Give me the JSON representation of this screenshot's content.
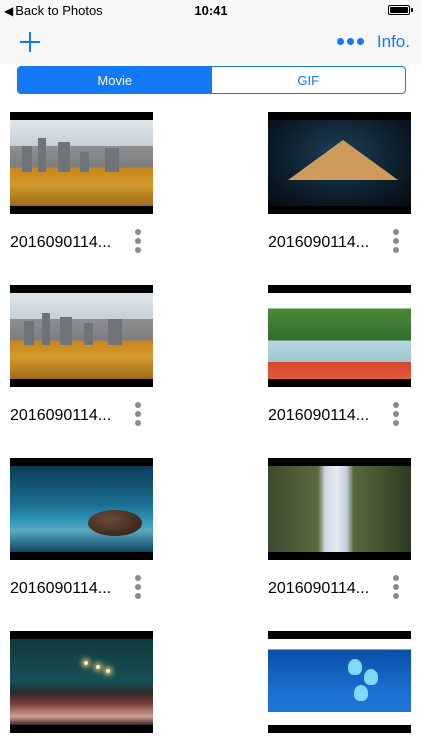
{
  "status_bar": {
    "back_label": "Back to Photos",
    "time": "10:41"
  },
  "nav": {
    "add_icon": "plus-icon",
    "more_icon": "ellipsis-icon",
    "info_label": "Info."
  },
  "tabs": [
    {
      "label": "Movie",
      "active": true
    },
    {
      "label": "GIF",
      "active": false
    }
  ],
  "items": [
    {
      "caption": "2016090114...",
      "scene": "city"
    },
    {
      "caption": "2016090114...",
      "scene": "mountain"
    },
    {
      "caption": "2016090114...",
      "scene": "city"
    },
    {
      "caption": "2016090114...",
      "scene": "lake"
    },
    {
      "caption": "2016090114...",
      "scene": "rock"
    },
    {
      "caption": "2016090114...",
      "scene": "falls"
    },
    {
      "caption": "",
      "scene": "road"
    },
    {
      "caption": "",
      "scene": "butterfly"
    }
  ],
  "colors": {
    "accent": "#1479f6",
    "bar_background": "#f7f7f7",
    "more_dots": "#8a8a8e"
  }
}
